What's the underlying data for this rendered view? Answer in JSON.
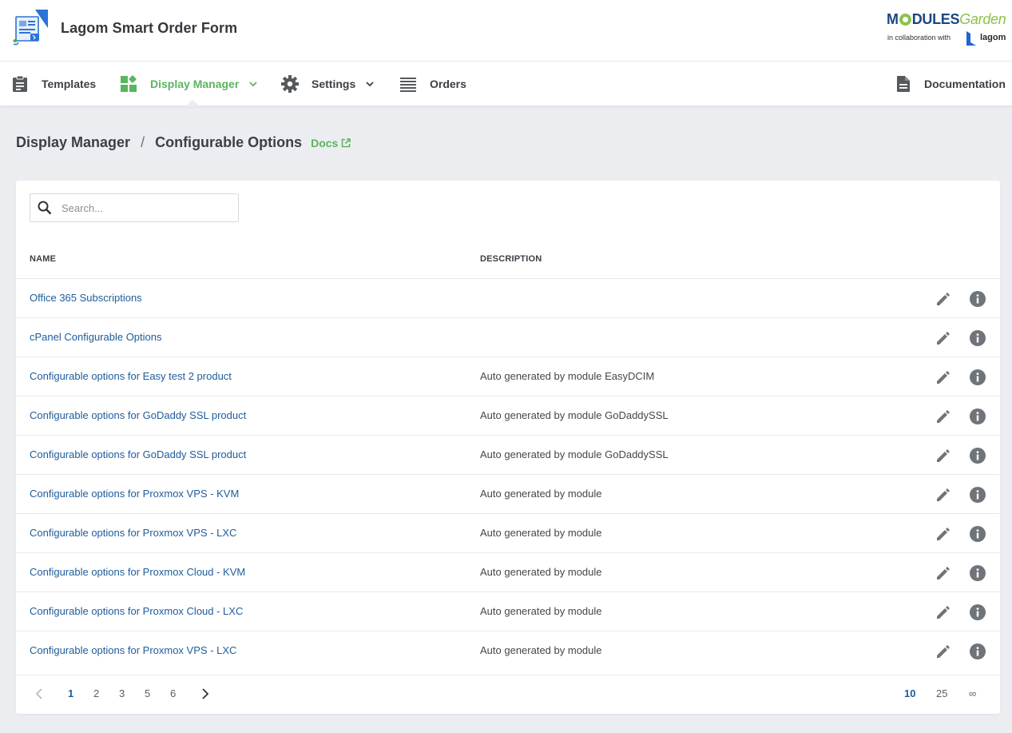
{
  "header": {
    "app_title": "Lagom Smart Order Form",
    "brand": {
      "name_part1": "M",
      "name_part2": "DULES",
      "name_part3": "Garden",
      "tagline": "in collaboration with",
      "partner": "lagom"
    }
  },
  "nav": {
    "items": [
      {
        "label": "Templates",
        "icon": "clipboard-icon",
        "active": false
      },
      {
        "label": "Display Manager",
        "icon": "widgets-icon",
        "active": true,
        "has_dropdown": true
      },
      {
        "label": "Settings",
        "icon": "gear-icon",
        "active": false,
        "has_dropdown": true
      },
      {
        "label": "Orders",
        "icon": "list-icon",
        "active": false
      }
    ],
    "documentation": {
      "label": "Documentation",
      "icon": "document-icon"
    }
  },
  "breadcrumb": {
    "parent": "Display Manager",
    "separator": "/",
    "current": "Configurable Options",
    "docs_label": "Docs"
  },
  "search": {
    "placeholder": "Search...",
    "value": ""
  },
  "table": {
    "columns": [
      "NAME",
      "DESCRIPTION"
    ],
    "rows": [
      {
        "name": "Office 365 Subscriptions",
        "description": ""
      },
      {
        "name": "cPanel Configurable Options",
        "description": ""
      },
      {
        "name": "Configurable options for Easy test 2 product",
        "description": "Auto generated by module EasyDCIM"
      },
      {
        "name": "Configurable options for GoDaddy SSL product",
        "description": "Auto generated by module GoDaddySSL"
      },
      {
        "name": "Configurable options for GoDaddy SSL product",
        "description": "Auto generated by module GoDaddySSL"
      },
      {
        "name": "Configurable options for Proxmox VPS - KVM",
        "description": "Auto generated by module"
      },
      {
        "name": "Configurable options for Proxmox VPS - LXC",
        "description": "Auto generated by module"
      },
      {
        "name": "Configurable options for Proxmox Cloud - KVM",
        "description": "Auto generated by module"
      },
      {
        "name": "Configurable options for Proxmox Cloud - LXC",
        "description": "Auto generated by module"
      },
      {
        "name": "Configurable options for Proxmox VPS - LXC",
        "description": "Auto generated by module"
      }
    ]
  },
  "pagination": {
    "pages": [
      "1",
      "2",
      "3",
      "5",
      "6"
    ],
    "current_page": "1",
    "per_page_options": [
      "10",
      "25",
      "∞"
    ],
    "per_page_selected": "10"
  },
  "colors": {
    "accent_green": "#5ab55e",
    "link_blue": "#1e5c9b",
    "icon_gray": "#6f747a",
    "background": "#ecedf1"
  }
}
